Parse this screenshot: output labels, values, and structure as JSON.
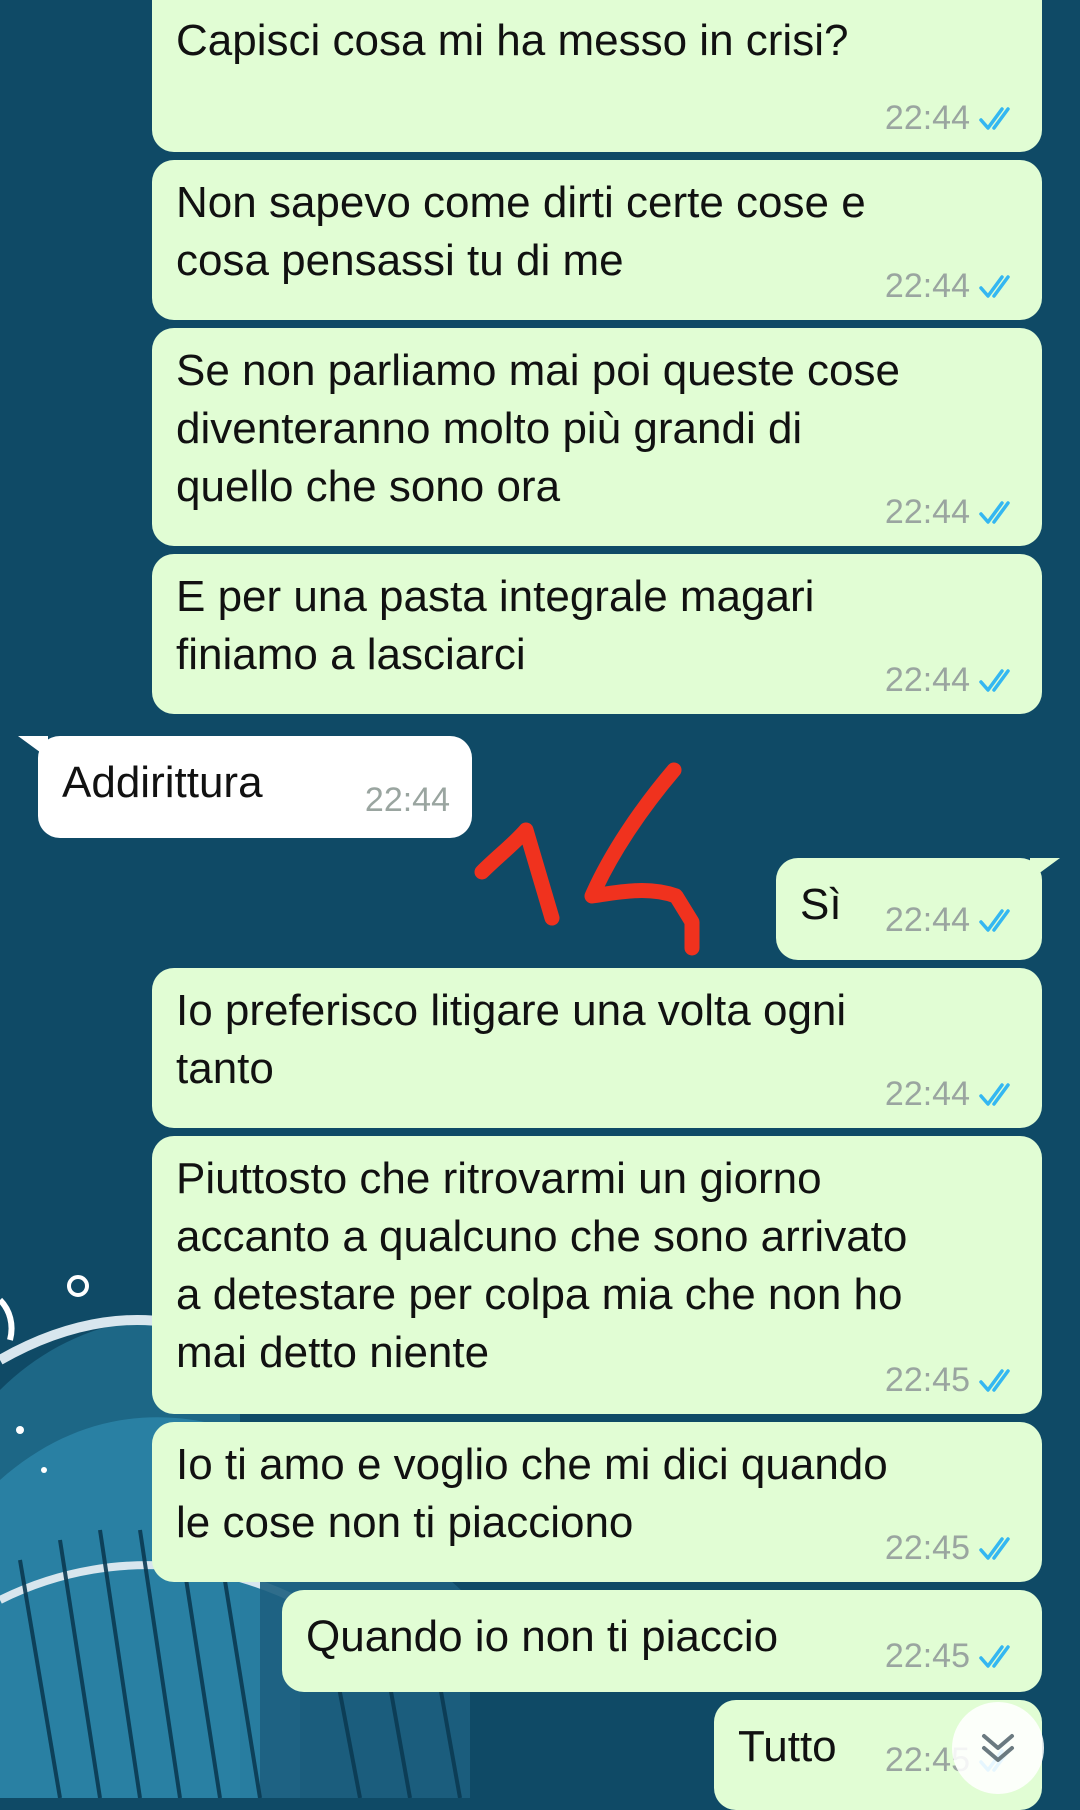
{
  "messages": [
    {
      "text": "Capisci cosa mi ha messo in crisi?",
      "time": "22:44"
    },
    {
      "text": "Non sapevo come dirti certe cose e\ncosa pensassi tu di me",
      "time": "22:44"
    },
    {
      "text": "Se non parliamo mai poi queste cose\ndiventeranno molto più grandi di\nquello che sono ora",
      "time": "22:44"
    },
    {
      "text": "E per una pasta integrale magari\nfiniamo a lasciarci",
      "time": "22:44"
    },
    {
      "text": "Addirittura",
      "time": "22:44"
    },
    {
      "text": "Sì",
      "time": "22:44"
    },
    {
      "text": "Io preferisco litigare una volta ogni\ntanto",
      "time": "22:44"
    },
    {
      "text": "Piuttosto che ritrovarmi un giorno\naccanto a qualcuno che sono arrivato\na detestare per colpa mia che non ho\nmai detto niente",
      "time": "22:45"
    },
    {
      "text": "Io ti amo e voglio che mi dici quando\nle cose non ti piacciono",
      "time": "22:45"
    },
    {
      "text": "Quando io non ti piaccio",
      "time": "22:45"
    },
    {
      "text": "Tutto",
      "time": "22:45"
    }
  ],
  "annotation": {
    "text": "14",
    "color": "#f0321e"
  },
  "colors": {
    "outgoing_bubble": "#e1fdd4",
    "incoming_bubble": "#ffffff",
    "read_ticks": "#34b7f1",
    "wallpaper": "#0f4a66"
  },
  "icons": {
    "read_receipt": "double-check-icon",
    "scroll_down": "chevron-double-down-icon"
  }
}
